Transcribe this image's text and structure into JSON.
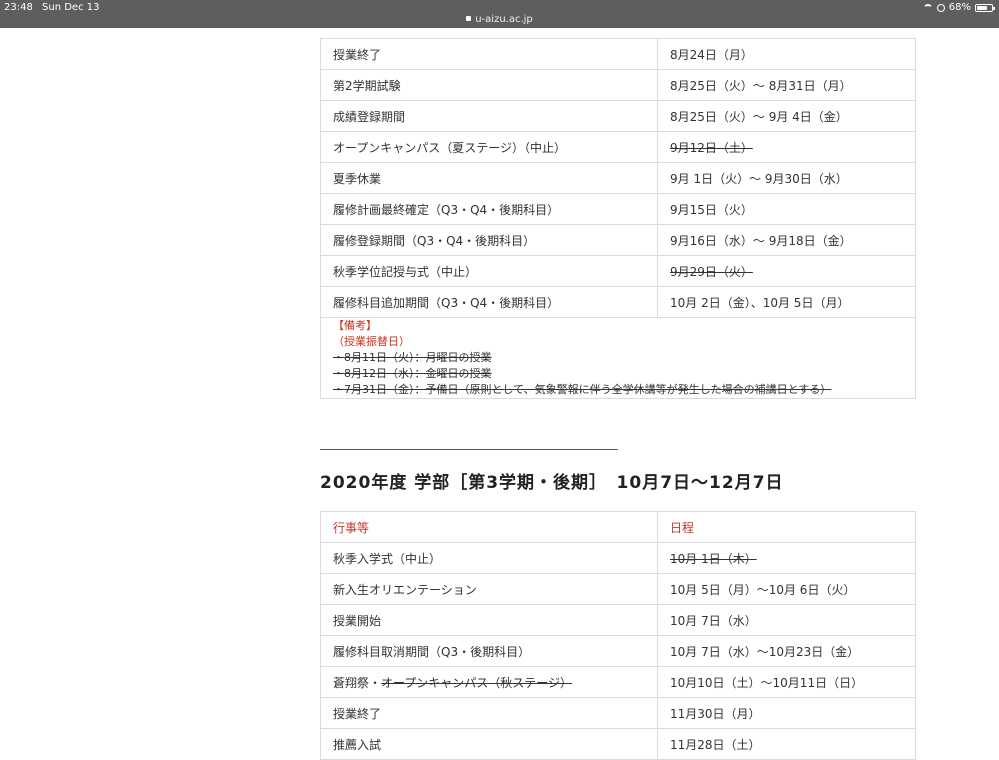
{
  "status_bar": {
    "time": "23:48",
    "date": "Sun Dec 13",
    "url": "u-aizu.ac.jp",
    "battery": "68%",
    "battery_level": 0.68
  },
  "table1": {
    "rows": [
      {
        "event": "授業終了",
        "date": "8月24日（月）",
        "strike_date": false
      },
      {
        "event": "第2学期試験",
        "date": "8月25日（火）～ 8月31日（月）",
        "strike_date": false
      },
      {
        "event": "成績登録期間",
        "date": "8月25日（火）～ 9月 4日（金）",
        "strike_date": false
      },
      {
        "event": "オープンキャンパス（夏ステージ）（中止）",
        "date": "9月12日（土）",
        "strike_date": true
      },
      {
        "event": "夏季休業",
        "date": "9月 1日（火）～ 9月30日（水）",
        "strike_date": false
      },
      {
        "event": "履修計画最終確定（Q3・Q4・後期科目）",
        "date": "9月15日（火）",
        "strike_date": false
      },
      {
        "event": "履修登録期間（Q3・Q4・後期科目）",
        "date": "9月16日（水）～ 9月18日（金）",
        "strike_date": false
      },
      {
        "event": "秋季学位記授与式（中止）",
        "date": "9月29日（火）",
        "strike_date": true
      },
      {
        "event": "履修科目追加期間（Q3・Q4・後期科目）",
        "date": "10月 2日（金）、10月 5日（月）",
        "strike_date": false
      }
    ],
    "notes": {
      "title": "【備考】",
      "subtitle": "（授業振替日）",
      "lines": [
        "・8月11日（火）：月曜日の授業",
        "・8月12日（水）：金曜日の授業",
        "・7月31日（金）：予備日（原則として、気象警報に伴う全学休講等が発生した場合の補講日とする）"
      ]
    }
  },
  "section2": {
    "heading": "2020年度 学部［第3学期・後期］　10月7日～12月7日",
    "header": {
      "event": "行事等",
      "date": "日程"
    },
    "rows": [
      {
        "event": "秋季入学式（中止）",
        "date": "10月 1日（木）",
        "strike_date": true
      },
      {
        "event": "新入生オリエンテーション",
        "date": "10月 5日（月）～10月 6日（火）",
        "strike_date": false
      },
      {
        "event": "授業開始",
        "date": "10月 7日（水）",
        "strike_date": false
      },
      {
        "event": "履修科目取消期間（Q3・後期科目）",
        "date": "10月 7日（水）～10月23日（金）",
        "strike_date": false
      },
      {
        "event_prefix": "蒼翔祭・",
        "event_struck": "オープンキャンパス（秋ステージ）",
        "date": "10月10日（土）～10月11日（日）",
        "strike_date": false
      },
      {
        "event": "授業終了",
        "date": "11月30日（月）",
        "strike_date": false
      },
      {
        "event": "推薦入試",
        "date": "11月28日（土）",
        "strike_date": false
      }
    ]
  }
}
